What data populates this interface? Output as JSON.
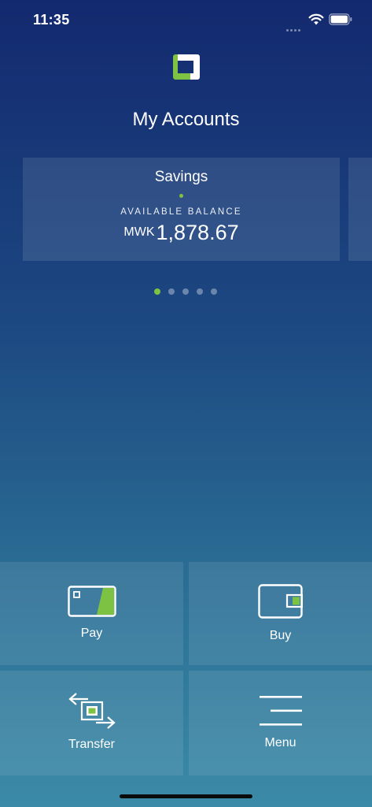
{
  "status_bar": {
    "time": "11:35",
    "icons": [
      "signal-dots-icon",
      "wifi-icon",
      "battery-icon"
    ]
  },
  "header": {
    "logo_icon": "bank-logo-icon",
    "title": "My Accounts"
  },
  "accounts": [
    {
      "name": "Savings",
      "balance_label": "AVAILABLE BALANCE",
      "currency": "MWK",
      "amount": "1,878.67"
    }
  ],
  "pager": {
    "count": 5,
    "active_index": 0
  },
  "actions": {
    "pay": {
      "label": "Pay",
      "icon": "card-icon"
    },
    "buy": {
      "label": "Buy",
      "icon": "wallet-icon"
    },
    "transfer": {
      "label": "Transfer",
      "icon": "transfer-arrows-icon"
    },
    "menu": {
      "label": "Menu",
      "icon": "hamburger-menu-icon"
    }
  },
  "colors": {
    "accent": "#7dc242",
    "background_top": "#13296f",
    "background_bottom": "#3b8aa7"
  }
}
